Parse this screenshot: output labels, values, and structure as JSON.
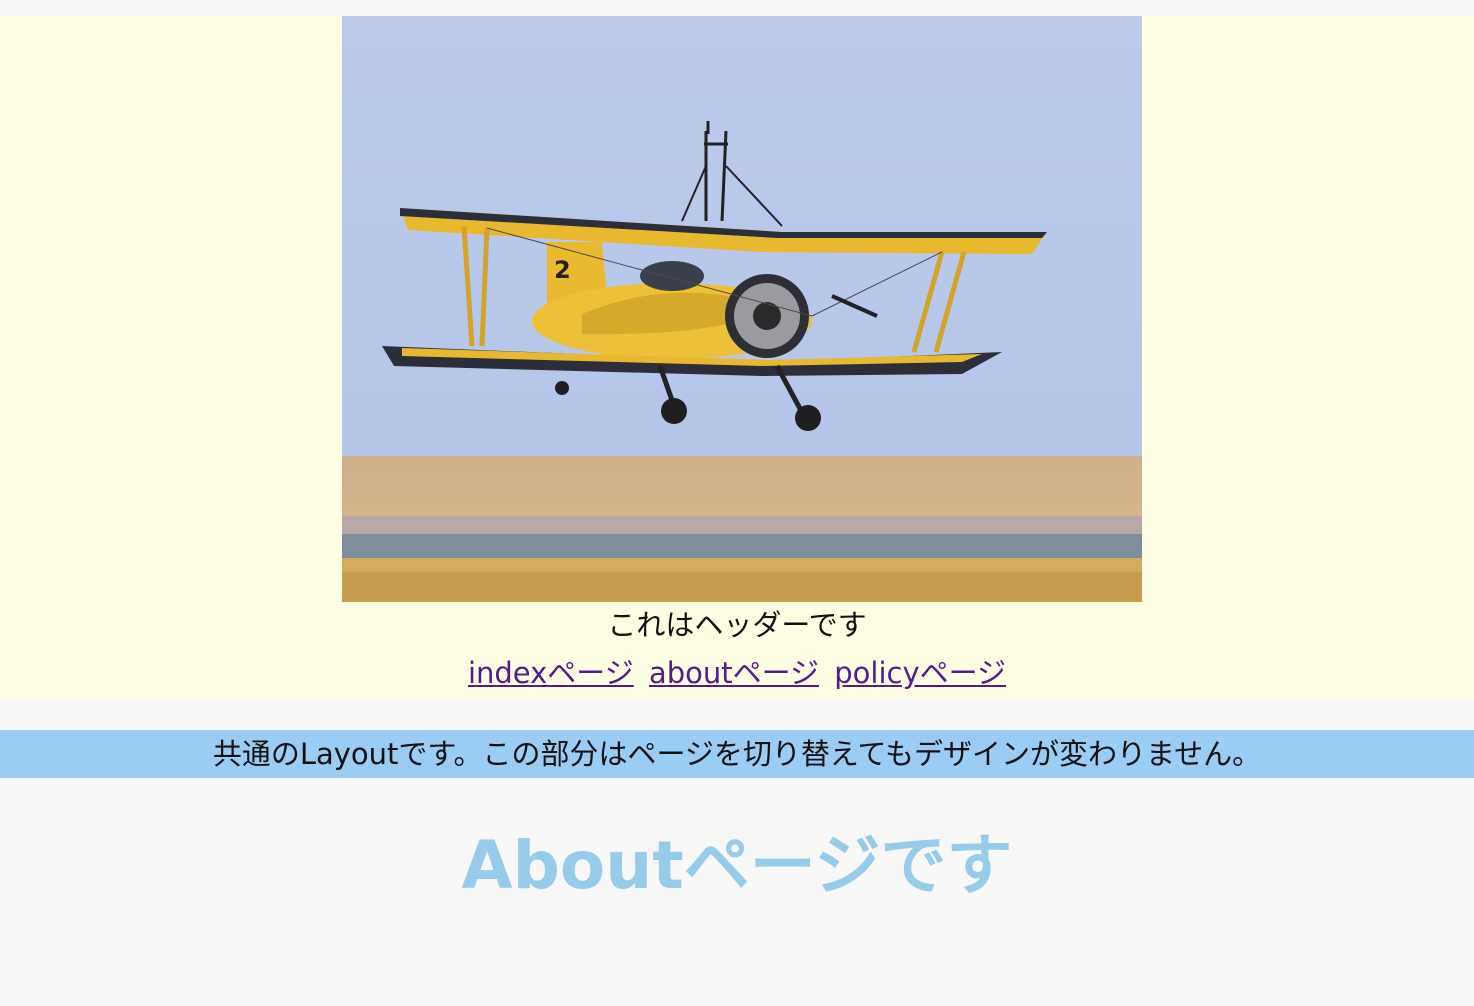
{
  "header": {
    "hero_image": "yellow-biplane-photo",
    "text": "これはヘッダーです"
  },
  "nav": {
    "links": [
      {
        "label": "indexページ"
      },
      {
        "label": "aboutページ"
      },
      {
        "label": "policyページ"
      }
    ]
  },
  "layout_banner": {
    "text": "共通のLayoutです。この部分はページを切り替えてもデザインが変わりません。"
  },
  "main": {
    "title": "Aboutページです"
  },
  "colors": {
    "header_bg": "#ffffe4",
    "banner_bg": "#9acdf4",
    "title": "#95ccec",
    "link_visited": "#551a8b",
    "page_bg": "#f8f8f9"
  }
}
